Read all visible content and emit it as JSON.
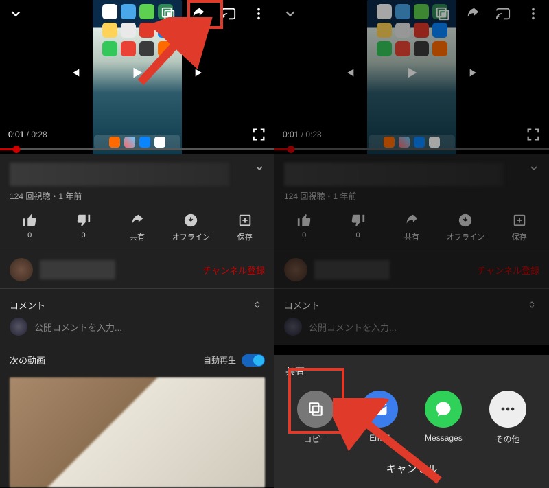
{
  "video": {
    "current_time": "0:01",
    "duration": "0:28"
  },
  "meta": {
    "views": "124 回視聴",
    "sep": "・",
    "age": "1 年前"
  },
  "actions": {
    "like_count": "0",
    "dislike_count": "0",
    "share": "共有",
    "offline": "オフライン",
    "save": "保存"
  },
  "subscribe_label": "チャンネル登録",
  "comments": {
    "header": "コメント",
    "placeholder": "公開コメントを入力..."
  },
  "next": {
    "header": "次の動画",
    "autoplay_label": "自動再生"
  },
  "sheet": {
    "title": "共有",
    "copy": "コピー",
    "email": "Email",
    "messages": "Messages",
    "other": "その他",
    "cancel": "キャンセル"
  }
}
